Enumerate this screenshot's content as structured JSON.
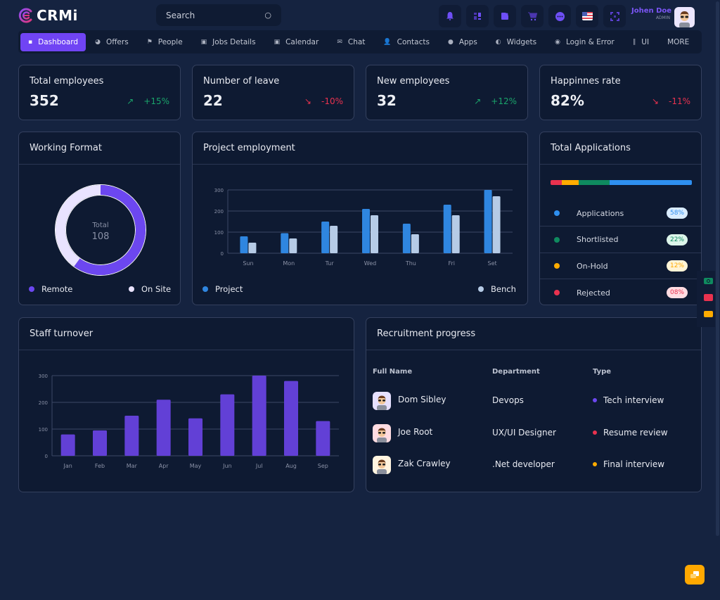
{
  "app": {
    "name": "CRMi"
  },
  "search": {
    "placeholder": "Search"
  },
  "header_icons": [
    "bell-icon",
    "layout-icon",
    "document-icon",
    "cart-icon",
    "chat-bubble-icon",
    "us-flag-icon",
    "fullscreen-icon"
  ],
  "user": {
    "name": "Johen Doe",
    "role": "ADMIN"
  },
  "nav": [
    {
      "label": "Dashboard",
      "icon": "grid-icon",
      "glyph": "▪",
      "active": true
    },
    {
      "label": "Offers",
      "icon": "pie-icon",
      "glyph": "◕"
    },
    {
      "label": "People",
      "icon": "flag-icon",
      "glyph": "⚑"
    },
    {
      "label": "Jobs Details",
      "icon": "briefcase-icon",
      "glyph": "▣"
    },
    {
      "label": "Calendar",
      "icon": "calendar-icon",
      "glyph": "▣"
    },
    {
      "label": "Chat",
      "icon": "message-icon",
      "glyph": "✉"
    },
    {
      "label": "Contacts",
      "icon": "user-plus-icon",
      "glyph": "👤"
    },
    {
      "label": "Apps",
      "icon": "bulb-icon",
      "glyph": "●"
    },
    {
      "label": "Widgets",
      "icon": "widget-icon",
      "glyph": "◐"
    },
    {
      "label": "Login & Error",
      "icon": "target-icon",
      "glyph": "◉"
    },
    {
      "label": "UI",
      "icon": "library-icon",
      "glyph": "∥"
    },
    {
      "label": "MORE",
      "icon": "",
      "glyph": ""
    }
  ],
  "stats": [
    {
      "title": "Total employees",
      "value": "352",
      "arrow": "↗",
      "change": "+15%",
      "trend": "up"
    },
    {
      "title": "Number of leave",
      "value": "22",
      "arrow": "↘",
      "change": "-10%",
      "trend": "down"
    },
    {
      "title": "New employees",
      "value": "32",
      "arrow": "↗",
      "change": "+12%",
      "trend": "up"
    },
    {
      "title": "Happinnes rate",
      "value": "82%",
      "arrow": "↘",
      "change": "-11%",
      "trend": "down"
    }
  ],
  "working_format": {
    "title": "Working Format",
    "center_label": "Total",
    "center_value": "108",
    "legend": [
      {
        "label": "Remote",
        "color": "#6c47f0"
      },
      {
        "label": "On Site",
        "color": "#e9e3ff"
      }
    ]
  },
  "project_employment": {
    "title": "Project employment",
    "legend": [
      {
        "label": "Project",
        "color": "#2f86e0"
      },
      {
        "label": "Bench",
        "color": "#b6cbe6"
      }
    ]
  },
  "total_applications": {
    "title": "Total Applications",
    "items": [
      {
        "label": "Applications",
        "percent": "58%",
        "value": 58,
        "color": "#2e8ff0",
        "pill_bg": "#d9ecff",
        "pill_fg": "#2e8ff0"
      },
      {
        "label": "Shortlisted",
        "percent": "22%",
        "value": 22,
        "color": "#0f8a5f",
        "pill_bg": "#dcf5ea",
        "pill_fg": "#0f8a5f"
      },
      {
        "label": "On-Hold",
        "percent": "12%",
        "value": 12,
        "color": "#ffab00",
        "pill_bg": "#fff4d6",
        "pill_fg": "#ffab00"
      },
      {
        "label": "Rejected",
        "percent": "08%",
        "value": 8,
        "color": "#e9324f",
        "pill_bg": "#ffdce2",
        "pill_fg": "#e9324f"
      }
    ]
  },
  "staff_turnover": {
    "title": "Staff turnover"
  },
  "recruitment": {
    "title": "Recruitment progress",
    "columns": [
      "Full Name",
      "Department",
      "Type"
    ],
    "rows": [
      {
        "name": "Dom Sibley",
        "department": "Devops",
        "type": "Tech interview",
        "type_color": "#6c47f0",
        "avatar_bg": "#e6e0ff"
      },
      {
        "name": "Joe Root",
        "department": "UX/UI Designer",
        "type": "Resume review",
        "type_color": "#e9324f",
        "avatar_bg": "#ffdce2"
      },
      {
        "name": "Zak Crawley",
        "department": ".Net developer",
        "type": "Final interview",
        "type_color": "#ffab00",
        "avatar_bg": "#fff4e0"
      }
    ]
  },
  "side_buttons": [
    "money-icon",
    "image-icon",
    "copy-icon"
  ],
  "fab": {
    "icon": "copy-icon"
  },
  "chart_data": [
    {
      "type": "pie",
      "title": "Working Format",
      "categories": [
        "Remote",
        "On Site"
      ],
      "values": [
        60,
        40
      ],
      "center_text": "Total 108",
      "legend": "bottom"
    },
    {
      "type": "bar",
      "title": "Project employment",
      "categories": [
        "Sun",
        "Mon",
        "Tur",
        "Wed",
        "Thu",
        "Fri",
        "Set"
      ],
      "series": [
        {
          "name": "Project",
          "values": [
            80,
            95,
            150,
            210,
            140,
            230,
            300
          ],
          "color": "#2f86e0"
        },
        {
          "name": "Bench",
          "values": [
            50,
            70,
            130,
            180,
            90,
            180,
            270
          ],
          "color": "#b6cbe6"
        }
      ],
      "yticks": [
        0,
        100,
        200,
        300
      ],
      "ylim": [
        0,
        300
      ],
      "grid": true,
      "legend": "bottom",
      "xlabel": "",
      "ylabel": ""
    },
    {
      "type": "bar",
      "title": "Staff turnover",
      "categories": [
        "Jan",
        "Feb",
        "Mar",
        "Apr",
        "May",
        "Jun",
        "Jul",
        "Aug",
        "Sep"
      ],
      "series": [
        {
          "name": "Turnover",
          "values": [
            80,
            95,
            150,
            210,
            140,
            230,
            300,
            280,
            130
          ],
          "color": "#6240d6"
        }
      ],
      "yticks": [
        0,
        100,
        200,
        300
      ],
      "ylim": [
        0,
        300
      ],
      "grid": true,
      "legend": "none",
      "xlabel": "",
      "ylabel": ""
    },
    {
      "type": "bar",
      "title": "Total Applications",
      "categories": [
        "Rejected",
        "On-Hold",
        "Shortlisted",
        "Applications"
      ],
      "values": [
        8,
        12,
        22,
        58
      ],
      "orientation": "stacked-horizontal"
    }
  ]
}
